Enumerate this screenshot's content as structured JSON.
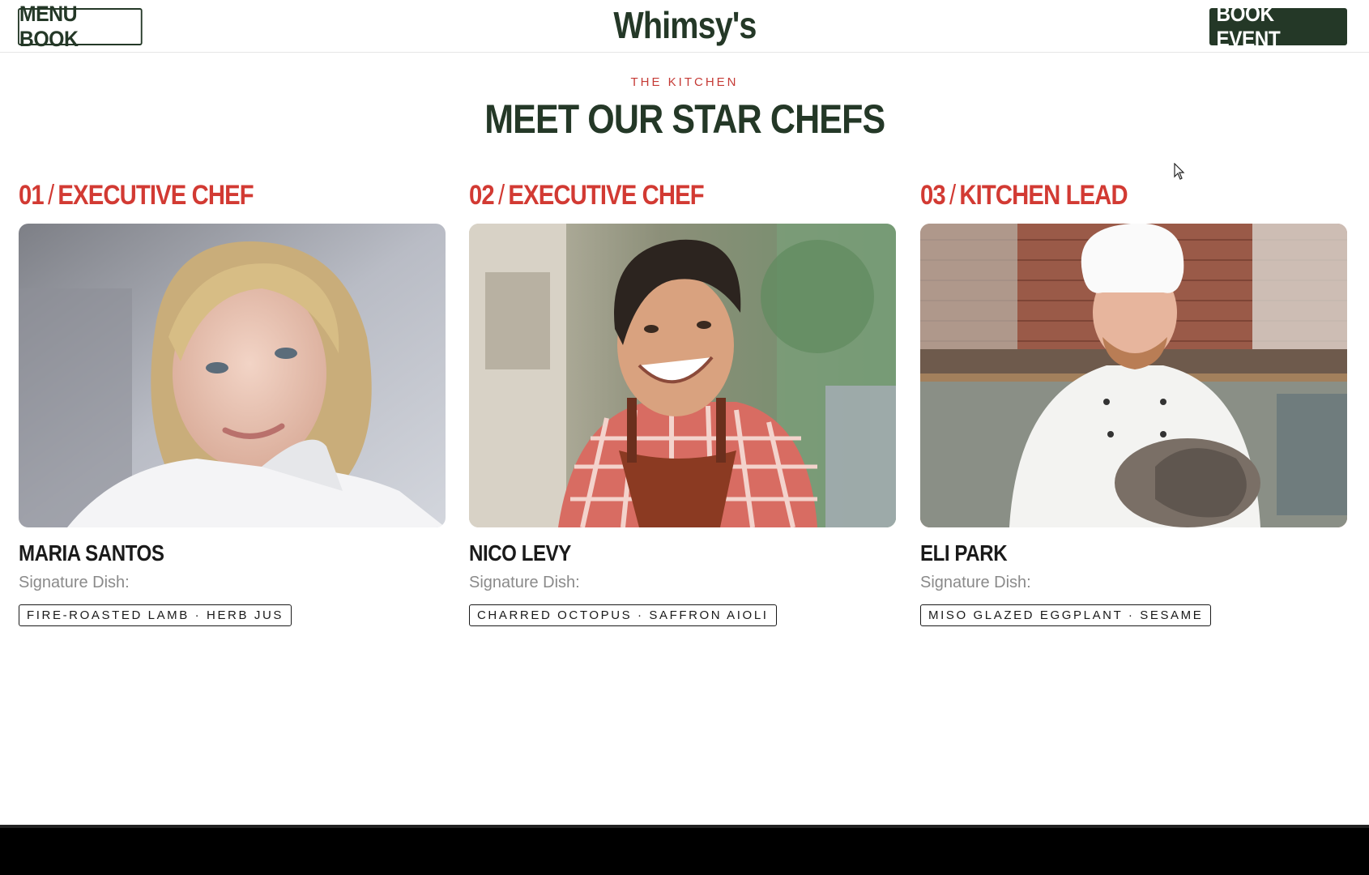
{
  "header": {
    "menu_label": "MENU BOOK",
    "logo": "Whimsy's",
    "book_label": "BOOK EVENT"
  },
  "section": {
    "eyebrow": "THE KITCHEN",
    "title": "MEET OUR STAR CHEFS"
  },
  "chefs": [
    {
      "number": "01",
      "role": "EXECUTIVE CHEF",
      "name": "MARIA SANTOS",
      "signature_label": "Signature Dish:",
      "dish": "FIRE-ROASTED LAMB · HERB JUS"
    },
    {
      "number": "02",
      "role": "EXECUTIVE CHEF",
      "name": "NICO LEVY",
      "signature_label": "Signature Dish:",
      "dish": "CHARRED OCTOPUS · SAFFRON AIOLI"
    },
    {
      "number": "03",
      "role": "KITCHEN LEAD",
      "name": "ELI PARK",
      "signature_label": "Signature Dish:",
      "dish": "MISO GLAZED EGGPLANT · SESAME"
    }
  ],
  "colors": {
    "brand_green": "#243827",
    "accent_red": "#d23a33",
    "eyebrow_red": "#c53a35"
  },
  "icons": {
    "cursor": "mouse-pointer-icon"
  }
}
